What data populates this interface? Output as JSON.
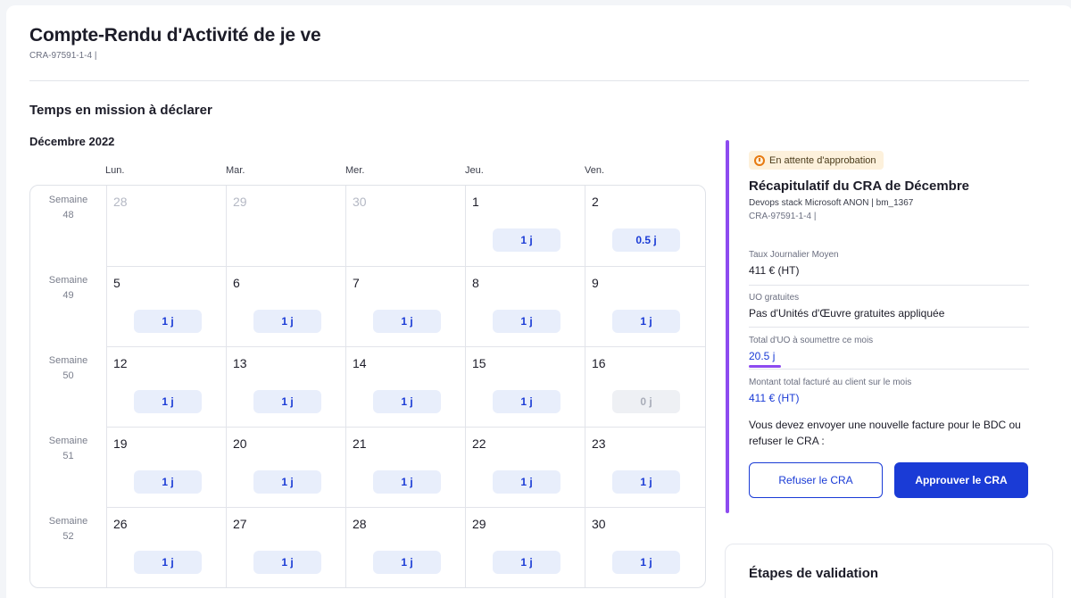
{
  "header": {
    "title": "Compte-Rendu d'Activité de je ve",
    "reference": "CRA-97591-1-4 |"
  },
  "section_title": "Temps en mission à déclarer",
  "calendar": {
    "month": "Décembre 2022",
    "day_headers": [
      "Lun.",
      "Mar.",
      "Mer.",
      "Jeu.",
      "Ven."
    ],
    "weeks": [
      {
        "label": "Semaine",
        "number": "48",
        "days": [
          {
            "num": "28",
            "value": "",
            "other": true
          },
          {
            "num": "29",
            "value": "",
            "other": true
          },
          {
            "num": "30",
            "value": "",
            "other": true
          },
          {
            "num": "1",
            "value": "1 j",
            "other": false
          },
          {
            "num": "2",
            "value": "0.5 j",
            "other": false
          }
        ]
      },
      {
        "label": "Semaine",
        "number": "49",
        "days": [
          {
            "num": "5",
            "value": "1 j"
          },
          {
            "num": "6",
            "value": "1 j"
          },
          {
            "num": "7",
            "value": "1 j"
          },
          {
            "num": "8",
            "value": "1 j"
          },
          {
            "num": "9",
            "value": "1 j"
          }
        ]
      },
      {
        "label": "Semaine",
        "number": "50",
        "days": [
          {
            "num": "12",
            "value": "1 j"
          },
          {
            "num": "13",
            "value": "1 j"
          },
          {
            "num": "14",
            "value": "1 j"
          },
          {
            "num": "15",
            "value": "1 j"
          },
          {
            "num": "16",
            "value": "0 j",
            "zero": true
          }
        ]
      },
      {
        "label": "Semaine",
        "number": "51",
        "days": [
          {
            "num": "19",
            "value": "1 j"
          },
          {
            "num": "20",
            "value": "1 j"
          },
          {
            "num": "21",
            "value": "1 j"
          },
          {
            "num": "22",
            "value": "1 j"
          },
          {
            "num": "23",
            "value": "1 j"
          }
        ]
      },
      {
        "label": "Semaine",
        "number": "52",
        "days": [
          {
            "num": "26",
            "value": "1 j"
          },
          {
            "num": "27",
            "value": "1 j"
          },
          {
            "num": "28",
            "value": "1 j"
          },
          {
            "num": "29",
            "value": "1 j"
          },
          {
            "num": "30",
            "value": "1 j"
          }
        ]
      }
    ]
  },
  "summary": {
    "status": "En attente d'approbation",
    "title": "Récapitulatif du CRA de Décembre",
    "mission": "Devops stack Microsoft ANON | bm_1367",
    "reference": "CRA-97591-1-4 |",
    "fields": [
      {
        "label": "Taux Journalier Moyen",
        "value": "411 € (HT)"
      },
      {
        "label": "UO gratuites",
        "value": "Pas d'Unités d'Œuvre gratuites appliquée"
      },
      {
        "label": "Total d'UO à soumettre ce mois",
        "value": "20.5 j"
      },
      {
        "label": "Montant total facturé au client sur le mois",
        "value": "411 € (HT)"
      }
    ],
    "notice": "Vous devez envoyer une nouvelle facture pour le BDC ou refuser le CRA :",
    "refuse_label": "Refuser le CRA",
    "approve_label": "Approuver le CRA",
    "accent_color": "#8d4bf0",
    "primary_color": "#1a3bd6"
  },
  "steps": {
    "title": "Étapes de validation"
  }
}
